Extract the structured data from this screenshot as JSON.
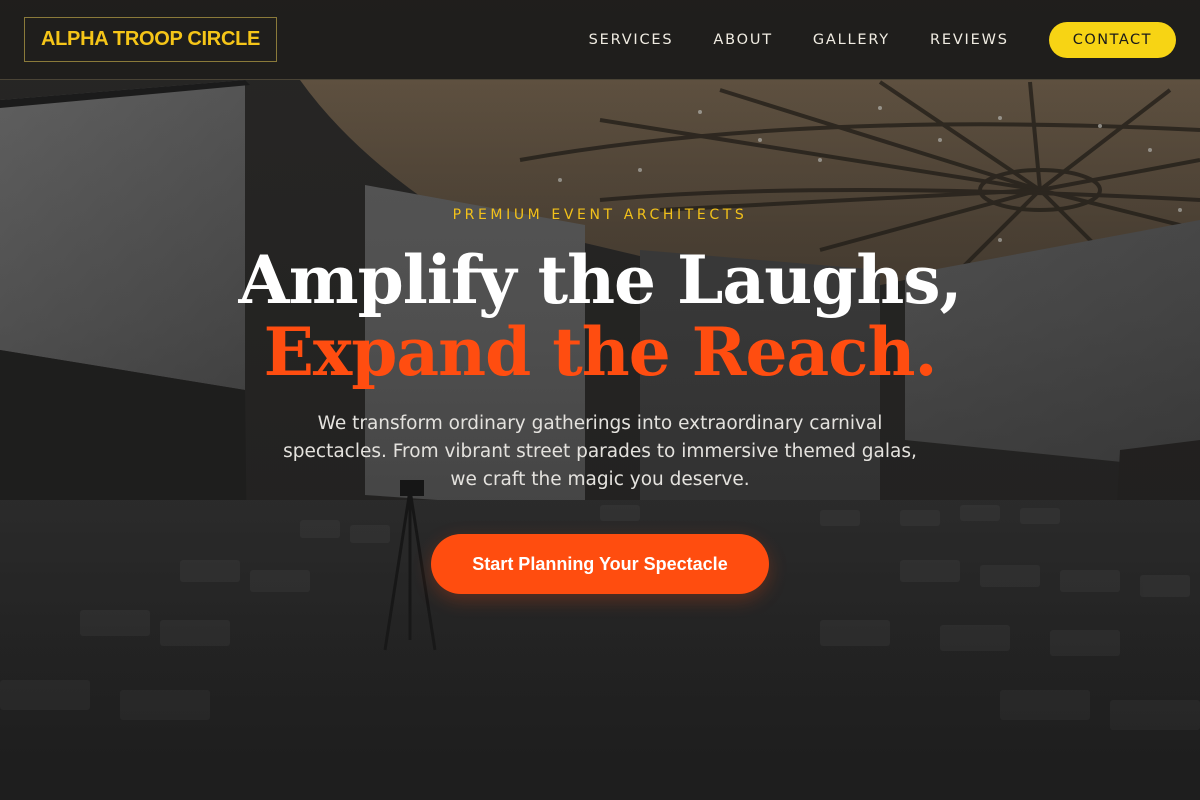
{
  "brand": {
    "name": "ALPHA TROOP CIRCLE"
  },
  "nav": {
    "items": [
      {
        "label": "SERVICES"
      },
      {
        "label": "ABOUT"
      },
      {
        "label": "GALLERY"
      },
      {
        "label": "REVIEWS"
      }
    ],
    "contact_label": "CONTACT"
  },
  "hero": {
    "eyebrow": "PREMIUM EVENT ARCHITECTS",
    "headline_line1": "Amplify the Laughs,",
    "headline_line2": "Expand the Reach.",
    "subtext": "We transform ordinary gatherings into extraordinary carnival spectacles. From vibrant street parades to immersive themed galas, we craft the magic you deserve.",
    "cta_label": "Start Planning Your Spectacle",
    "background_image": "auditorium-hall-photo"
  },
  "colors": {
    "accent_yellow": "#f7d414",
    "accent_orange": "#ff4d10",
    "header_bg": "#1e1d1b",
    "text_light": "#e4e2de"
  }
}
